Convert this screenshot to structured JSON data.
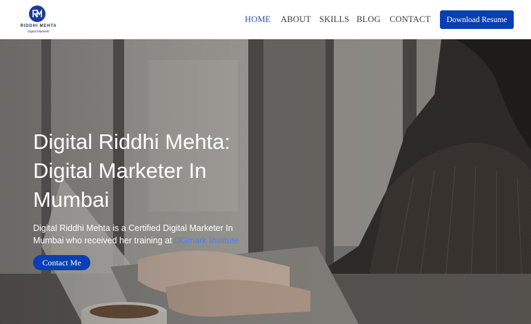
{
  "logo": {
    "name": "RIDDHI MEHTA",
    "tagline": "Digital Marketer",
    "mark": "RM"
  },
  "nav": {
    "items": [
      {
        "label": "HOME",
        "active": true
      },
      {
        "label": "ABOUT",
        "active": false
      },
      {
        "label": "SKILLS",
        "active": false
      },
      {
        "label": "BLOG",
        "active": false
      },
      {
        "label": "CONTACT",
        "active": false
      }
    ],
    "cta_label": "Download Resume"
  },
  "hero": {
    "title": "Digital Riddhi Mehta: Digital Marketer In Mumbai",
    "text_before_link": "Digital Riddhi Mehta is a Certified Digital Marketer In Mumbai who received her training at ",
    "link_text": "DGmark Institute",
    "button_label": "Contact Me"
  },
  "colors": {
    "primary": "#0a3fb3",
    "nav_active": "#2d52a8",
    "link": "#4f7dff"
  }
}
